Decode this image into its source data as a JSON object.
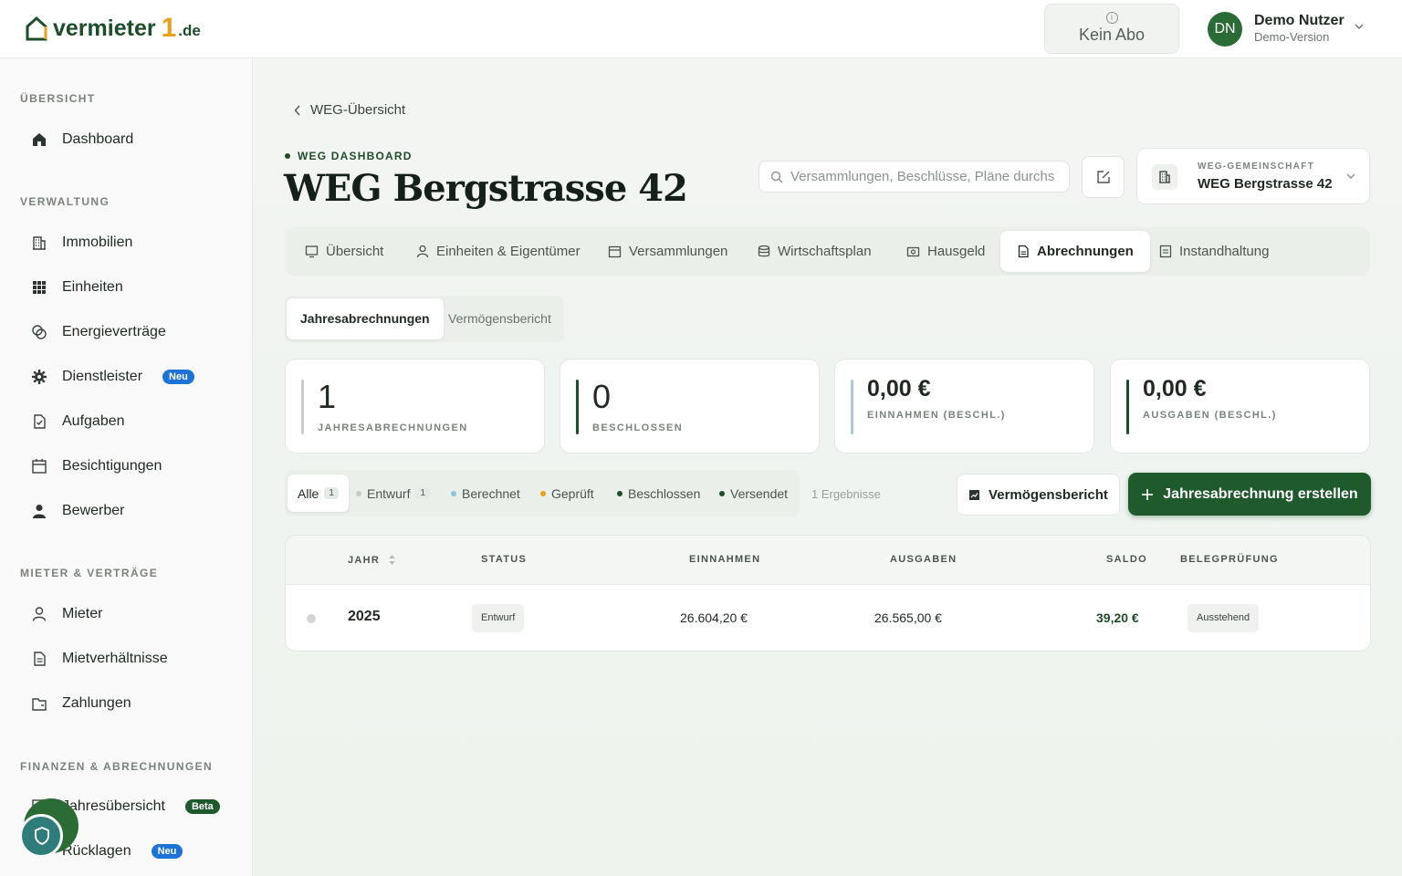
{
  "header": {
    "logo_main": "vermieter",
    "logo_one": "1",
    "logo_tld": ".de",
    "abo_label": "Kein Abo",
    "avatar_initials": "DN",
    "user_name": "Demo Nutzer",
    "user_sub": "Demo-Version"
  },
  "sidebar": {
    "sections": [
      "ÜBERSICHT",
      "VERWALTUNG",
      "MIETER & VERTRÄGE",
      "FINANZEN & ABRECHNUNGEN"
    ],
    "items": [
      {
        "label": "Dashboard",
        "icon": "home-icon"
      },
      {
        "label": "Immobilien",
        "icon": "building-icon"
      },
      {
        "label": "Einheiten",
        "icon": "grid-icon"
      },
      {
        "label": "Energieverträge",
        "icon": "energy-icon"
      },
      {
        "label": "Dienstleister",
        "icon": "gear-icon",
        "badge": "Neu"
      },
      {
        "label": "Aufgaben",
        "icon": "task-icon"
      },
      {
        "label": "Besichtigungen",
        "icon": "calendar-icon"
      },
      {
        "label": "Bewerber",
        "icon": "person-icon"
      },
      {
        "label": "Mieter",
        "icon": "user-icon"
      },
      {
        "label": "Mietverhältnisse",
        "icon": "document-icon"
      },
      {
        "label": "Zahlungen",
        "icon": "wallet-icon"
      },
      {
        "label": "Jahresübersicht",
        "icon": "chart-icon",
        "badge": "Beta"
      },
      {
        "label": "Rücklagen",
        "icon": "savings-icon",
        "badge": "Neu"
      }
    ]
  },
  "page": {
    "back_label": "WEG-Übersicht",
    "eyebrow": "WEG DASHBOARD",
    "title": "WEG Bergstrasse 42",
    "search_placeholder": "Versammlungen, Beschlüsse, Pläne durchsuchen",
    "weg_label": "WEG-GEMEINSCHAFT",
    "weg_value": "WEG Bergstrasse 42"
  },
  "tabs": [
    "Übersicht",
    "Einheiten & Eigentümer",
    "Versammlungen",
    "Wirtschaftsplan",
    "Hausgeld",
    "Abrechnungen",
    "Instandhaltung"
  ],
  "active_tab": "Abrechnungen",
  "sub_tabs": [
    "Jahresabrechnungen",
    "Vermögensbericht"
  ],
  "stats": [
    {
      "value": "1",
      "label": "JAHRESABRECHNUNGEN",
      "color": "#c9ccc9"
    },
    {
      "value": "0",
      "label": "BESCHLOSSEN",
      "color": "#1e4d2b"
    },
    {
      "value": "0,00 €",
      "label": "EINNAHMEN (BESCHL.)",
      "color": "#a9c9d6"
    },
    {
      "value": "0,00 €",
      "label": "AUSGABEN (BESCHL.)",
      "color": "#1e4d2b"
    }
  ],
  "filters": [
    {
      "label": "Alle",
      "count": "1"
    },
    {
      "label": "Entwurf",
      "count": "1",
      "color": "#c9ccc9"
    },
    {
      "label": "Berechnet",
      "color": "#8cc5d6"
    },
    {
      "label": "Geprüft",
      "color": "#e6a21a"
    },
    {
      "label": "Beschlossen",
      "color": "#1e4d2b"
    },
    {
      "label": "Versendet",
      "color": "#1e4d2b"
    }
  ],
  "result_count": "1 Ergebnisse",
  "actions": {
    "vermoegensbericht": "Vermögensbericht",
    "create": "Jahresabrechnung erstellen"
  },
  "table": {
    "headers": [
      "JAHR",
      "STATUS",
      "EINNAHMEN",
      "AUSGABEN",
      "SALDO",
      "BELEGPRÜFUNG"
    ],
    "rows": [
      {
        "jahr": "2025",
        "status": "Entwurf",
        "einnahmen": "26.604,20 €",
        "ausgaben": "26.565,00 €",
        "saldo": "39,20 €",
        "belegpruefung": "Ausstehend"
      }
    ]
  },
  "colors": {
    "brand": "#1f5a2c",
    "accent": "#e6a21a",
    "badge_blue": "#1d72d8"
  }
}
